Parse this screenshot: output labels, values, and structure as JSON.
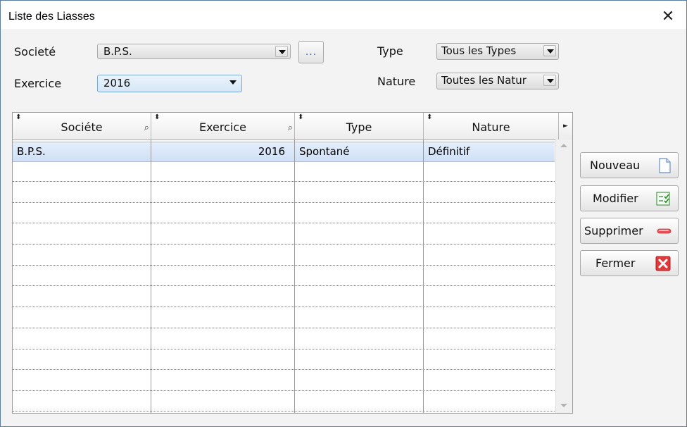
{
  "window": {
    "title": "Liste des Liasses",
    "close_glyph": "✕"
  },
  "filters": {
    "societe": {
      "label": "Societé",
      "value": "B.P.S."
    },
    "exercice": {
      "label": "Exercice",
      "value": "2016"
    },
    "browse_label": "...",
    "type": {
      "label": "Type",
      "value": "Tous les Types"
    },
    "nature": {
      "label": "Nature",
      "value": "Toutes les Natur"
    }
  },
  "grid": {
    "columns": [
      {
        "label": "Sociéte",
        "sort_glyph": "⬍",
        "filter_glyph": "⌕"
      },
      {
        "label": "Exercice",
        "sort_glyph": "⬍",
        "filter_glyph": "⌕"
      },
      {
        "label": "Type",
        "sort_glyph": "⬍"
      },
      {
        "label": "Nature",
        "sort_glyph": "⬍"
      }
    ],
    "more_glyph": "►",
    "rows": [
      {
        "societe": "B.P.S.",
        "exercice": "2016",
        "type": "Spontané",
        "nature": "Définitif",
        "selected": true
      }
    ]
  },
  "actions": {
    "nouveau": "Nouveau",
    "modifier": "Modifier",
    "supprimer": "Supprimer",
    "fermer": "Fermer"
  },
  "icons": {
    "new": "document-icon",
    "edit": "checklist-icon",
    "delete": "minus-icon",
    "close": "close-red-icon"
  },
  "colors": {
    "selection": "#d6e6f8",
    "accent": "#3b7bd0",
    "delete_red": "#e03a3a"
  }
}
